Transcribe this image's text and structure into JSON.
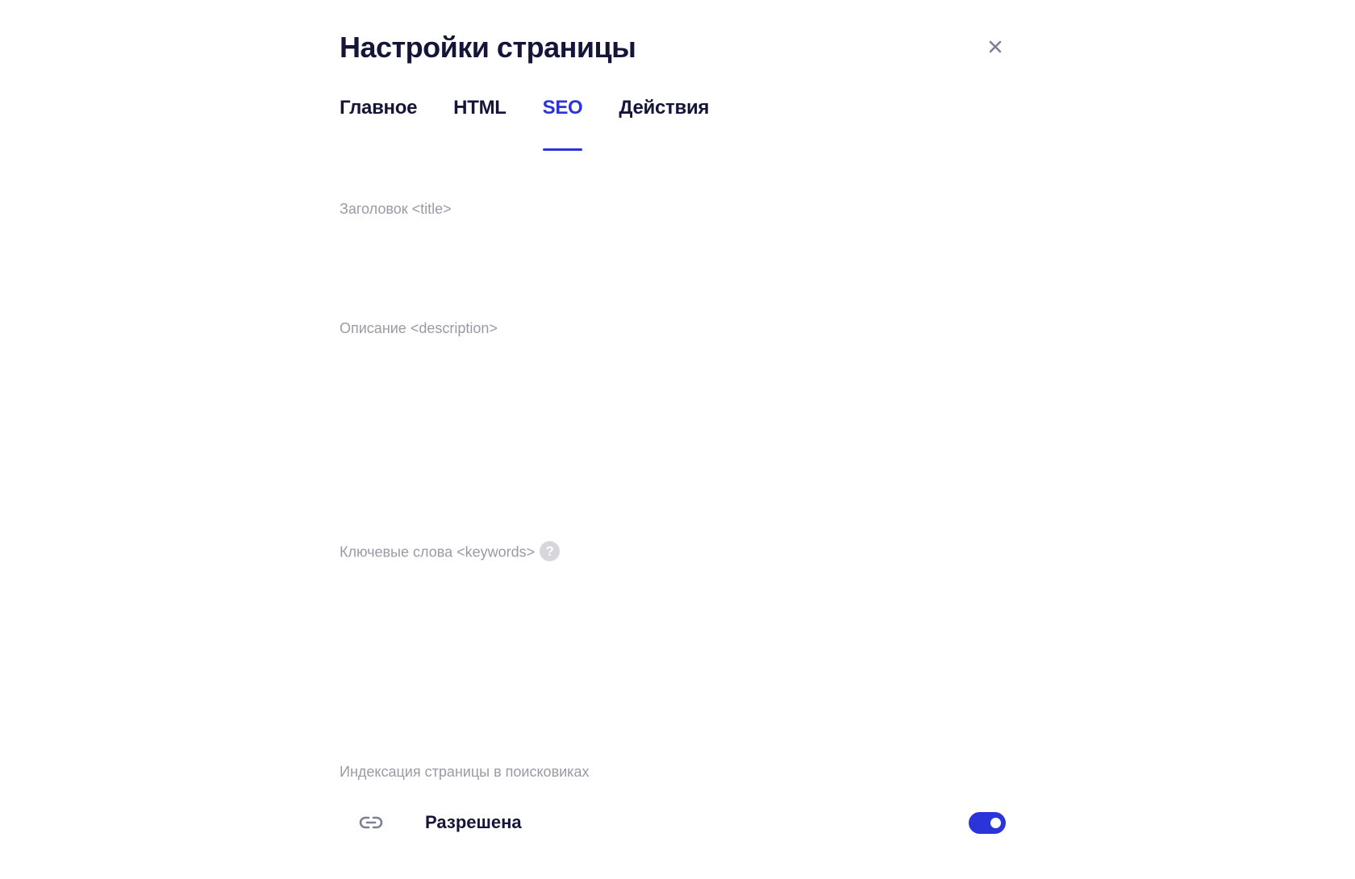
{
  "dialog": {
    "title": "Настройки страницы",
    "close_icon": "close-icon"
  },
  "tabs": [
    {
      "label": "Главное",
      "active": false
    },
    {
      "label": "HTML",
      "active": false
    },
    {
      "label": "SEO",
      "active": true
    },
    {
      "label": "Действия",
      "active": false
    }
  ],
  "seo": {
    "title_field": {
      "label": "Заголовок <title>",
      "value": ""
    },
    "description_field": {
      "label": "Описание <description>",
      "value": ""
    },
    "keywords_field": {
      "label": "Ключевые слова <keywords>",
      "value": "",
      "help_icon": "question-icon",
      "help_glyph": "?"
    },
    "indexing": {
      "label": "Индексация страницы в поисковиках",
      "icon": "link-icon",
      "value": "Разрешена",
      "enabled": true
    }
  },
  "colors": {
    "accent": "#2b34d9",
    "text": "#15153a",
    "muted": "#9a9aa6"
  }
}
